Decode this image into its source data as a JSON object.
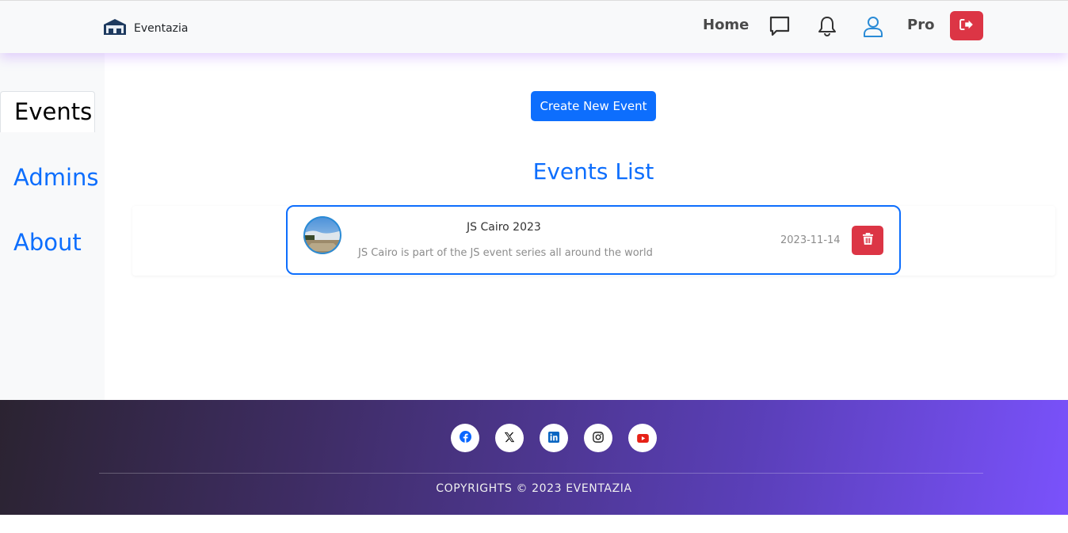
{
  "navbar": {
    "brand_name": "Eventazia",
    "home_label": "Home",
    "pro_label": "Pro",
    "icons": [
      "chat-icon",
      "bell-icon",
      "user-icon",
      "logout-icon"
    ],
    "logout_color": "#dc3545"
  },
  "sidebar": {
    "items": [
      {
        "label": "Events",
        "active": true
      },
      {
        "label": "Admins",
        "active": false
      },
      {
        "label": "About",
        "active": false
      }
    ]
  },
  "main": {
    "create_button_label": "Create New Event",
    "list_title": "Events List",
    "events": [
      {
        "title": "JS Cairo 2023",
        "description": "JS Cairo is part of the JS event series all around the world",
        "date": "2023-11-14"
      }
    ]
  },
  "footer": {
    "social_icons": [
      "facebook-icon",
      "x-icon",
      "linkedin-icon",
      "instagram-icon",
      "youtube-icon"
    ],
    "copyright": "COPYRIGHTS © 2023 EVENTAZIA"
  },
  "colors": {
    "primary": "#0d6efd",
    "danger": "#dc3545",
    "footer_gradient_start": "#2b2331",
    "footer_gradient_end": "#7a52fc"
  }
}
